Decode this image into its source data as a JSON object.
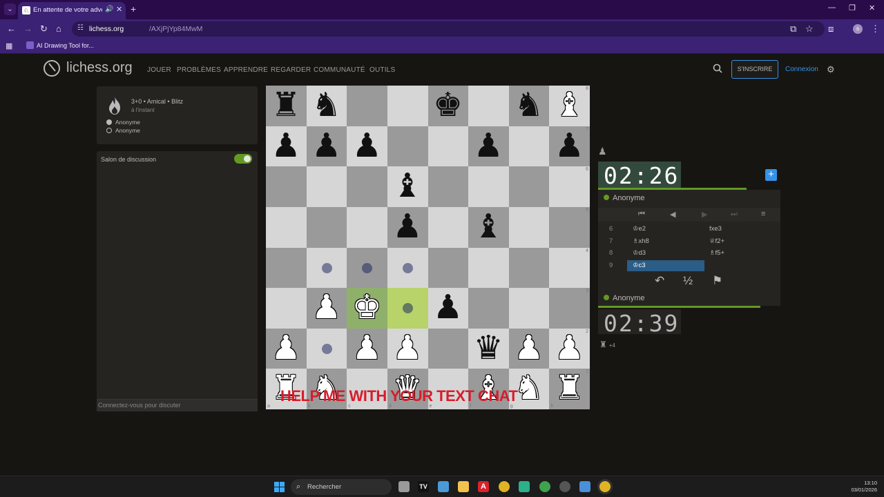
{
  "browser": {
    "tab_title": "En attente de votre advers",
    "url_host": "lichess.org",
    "url_path": "/AXjPjYp84MwM",
    "profile_initial": "s",
    "bookmark": "AI Drawing Tool for..."
  },
  "header": {
    "logo": "lichess.org",
    "nav": [
      "JOUER",
      "PROBLÈMES",
      "APPRENDRE",
      "REGARDER",
      "COMMUNAUTÉ",
      "OUTILS"
    ],
    "signup": "S'INSCRIRE",
    "login": "Connexion"
  },
  "game_info": {
    "setup": "3+0 • Amical • Blitz",
    "time": "à l'instant",
    "white_player": "Anonyme",
    "black_player": "Anonyme"
  },
  "chat": {
    "title": "Salon de discussion",
    "placeholder": "Connectez-vous pour discuter",
    "enabled": true
  },
  "board": {
    "pieces": [
      {
        "sq": "a8",
        "p": "bR"
      },
      {
        "sq": "b8",
        "p": "bN"
      },
      {
        "sq": "e8",
        "p": "wK_black"
      },
      {
        "sq": "g8",
        "p": "bN"
      },
      {
        "sq": "h8",
        "p": "bB_white"
      },
      {
        "sq": "a7",
        "p": "bP"
      },
      {
        "sq": "b7",
        "p": "bP"
      },
      {
        "sq": "c7",
        "p": "bP"
      },
      {
        "sq": "f7",
        "p": "bP"
      },
      {
        "sq": "h7",
        "p": "bP"
      },
      {
        "sq": "d6",
        "p": "bB"
      },
      {
        "sq": "d5",
        "p": "bP"
      },
      {
        "sq": "f5",
        "p": "bB"
      },
      {
        "sq": "b3",
        "p": "wP"
      },
      {
        "sq": "c3",
        "p": "wK"
      },
      {
        "sq": "e3",
        "p": "bP"
      },
      {
        "sq": "a2",
        "p": "wP"
      },
      {
        "sq": "c2",
        "p": "wP"
      },
      {
        "sq": "d2",
        "p": "wP"
      },
      {
        "sq": "f2",
        "p": "bQ"
      },
      {
        "sq": "g2",
        "p": "wP"
      },
      {
        "sq": "h2",
        "p": "wP"
      },
      {
        "sq": "a1",
        "p": "wR"
      },
      {
        "sq": "b1",
        "p": "wN"
      },
      {
        "sq": "d1",
        "p": "wQ"
      },
      {
        "sq": "f1",
        "p": "wB"
      },
      {
        "sq": "g1",
        "p": "wN"
      },
      {
        "sq": "h1",
        "p": "wR"
      }
    ],
    "move_dots": [
      "b4",
      "c4",
      "d4",
      "d3",
      "b2"
    ],
    "last_move_from": "c3",
    "last_move_to": "d3",
    "overlay_text": "HELP ME WITH YOUR TEXT CHAT"
  },
  "clocks": {
    "top": "02:26",
    "bottom": "02:39",
    "top_player": "Anonyme",
    "bottom_player": "Anonyme",
    "material_diff": "+4"
  },
  "moves": [
    {
      "n": "6",
      "w": "♔e2",
      "b": "fxe3"
    },
    {
      "n": "7",
      "w": "♗xh8",
      "b": "♕f2+"
    },
    {
      "n": "8",
      "w": "♔d3",
      "b": "♗f5+"
    },
    {
      "n": "9",
      "w": "♔c3",
      "b": ""
    }
  ],
  "taskbar": {
    "search": "Rechercher",
    "time": "13:10",
    "date": "03/01/2026"
  }
}
